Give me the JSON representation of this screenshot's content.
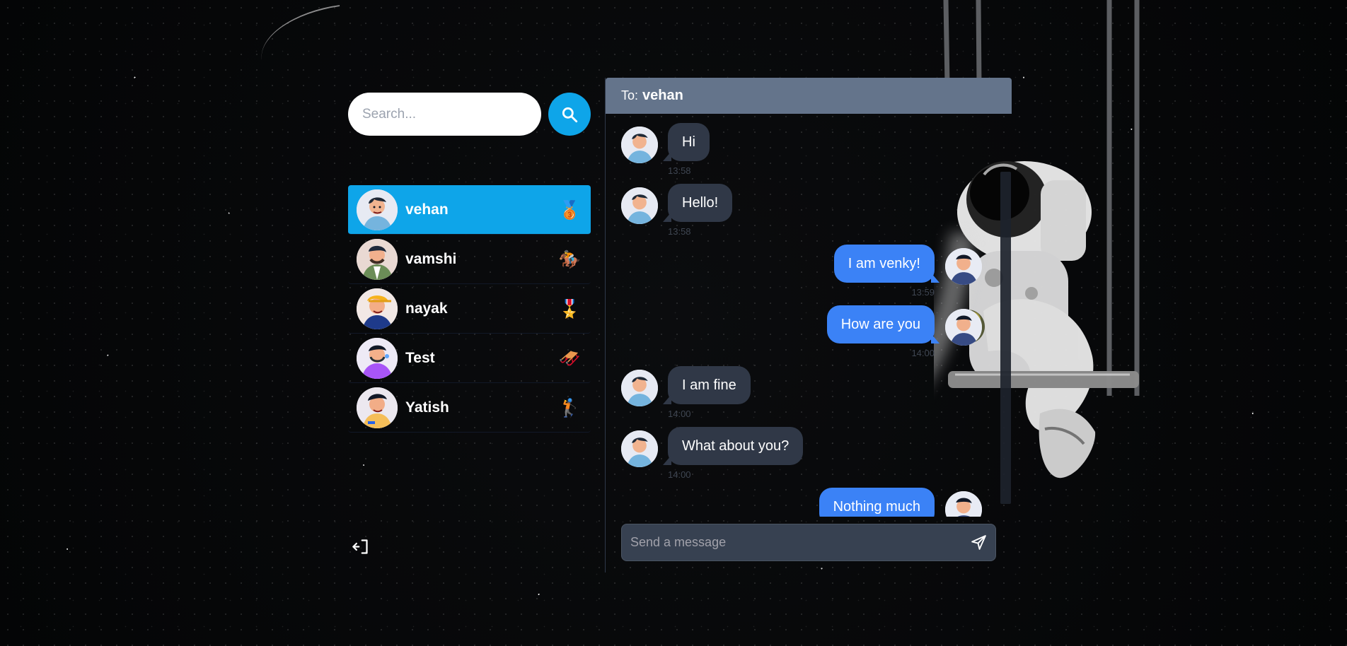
{
  "search": {
    "placeholder": "Search..."
  },
  "conversations": [
    {
      "name": "vehan",
      "emoji": "🥉",
      "active": true
    },
    {
      "name": "vamshi",
      "emoji": "🏇",
      "active": false
    },
    {
      "name": "nayak",
      "emoji": "🎖️",
      "active": false
    },
    {
      "name": "Test",
      "emoji": "🛷",
      "active": false
    },
    {
      "name": "Yatish",
      "emoji": "🏌️",
      "active": false
    }
  ],
  "chat": {
    "to_label": "To:",
    "recipient": "vehan",
    "messages": [
      {
        "text": "Hi",
        "time": "13:58",
        "direction": "received"
      },
      {
        "text": "Hello!",
        "time": "13:58",
        "direction": "received"
      },
      {
        "text": "I am venky!",
        "time": "13:59",
        "direction": "sent"
      },
      {
        "text": "How are you",
        "time": "14:00",
        "direction": "sent"
      },
      {
        "text": "I am fine",
        "time": "14:00",
        "direction": "received"
      },
      {
        "text": "What about you?",
        "time": "14:00",
        "direction": "received"
      },
      {
        "text": "Nothing much",
        "time": "",
        "direction": "sent"
      }
    ],
    "composer_placeholder": "Send a message"
  },
  "icons": {
    "search": "search-icon",
    "logout": "logout-icon",
    "send": "send-icon"
  },
  "colors": {
    "active_conversation": "#0ea5e9",
    "header": "#64748b",
    "received_bubble": "#303847",
    "sent_bubble": "#3b82f6"
  }
}
